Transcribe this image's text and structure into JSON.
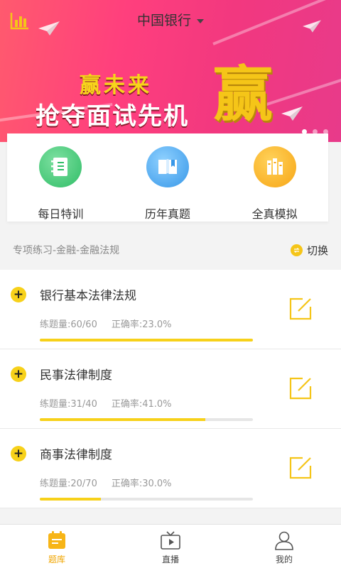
{
  "header": {
    "title": "中国银行"
  },
  "banner": {
    "slogan_top": "赢未来",
    "slogan_main": "抢夺面试先机",
    "big_char": "赢"
  },
  "categories": [
    {
      "label": "每日特训",
      "icon": "notebook-icon",
      "color": "#2fbd66"
    },
    {
      "label": "历年真题",
      "icon": "book-icon",
      "color": "#3797e8"
    },
    {
      "label": "全真模拟",
      "icon": "books-icon",
      "color": "#f7a515"
    }
  ],
  "section": {
    "path": "专项练习-金融-金融法规",
    "switch_label": "切换"
  },
  "items": [
    {
      "name": "银行基本法律法规",
      "count_text": "练题量:60/60",
      "accuracy_text": "正确率:23.0%",
      "progress": 1.0
    },
    {
      "name": "民事法律制度",
      "count_text": "练题量:31/40",
      "accuracy_text": "正确率:41.0%",
      "progress": 0.775
    },
    {
      "name": "商事法律制度",
      "count_text": "练题量:20/70",
      "accuracy_text": "正确率:30.0%",
      "progress": 0.286
    }
  ],
  "nav": [
    {
      "label": "题库",
      "icon": "question-bank-icon",
      "active": true
    },
    {
      "label": "直播",
      "icon": "tv-icon",
      "active": false
    },
    {
      "label": "我的",
      "icon": "user-icon",
      "active": false
    }
  ],
  "colors": {
    "accent": "#f7d11a",
    "banner": "#ff3f7d"
  }
}
